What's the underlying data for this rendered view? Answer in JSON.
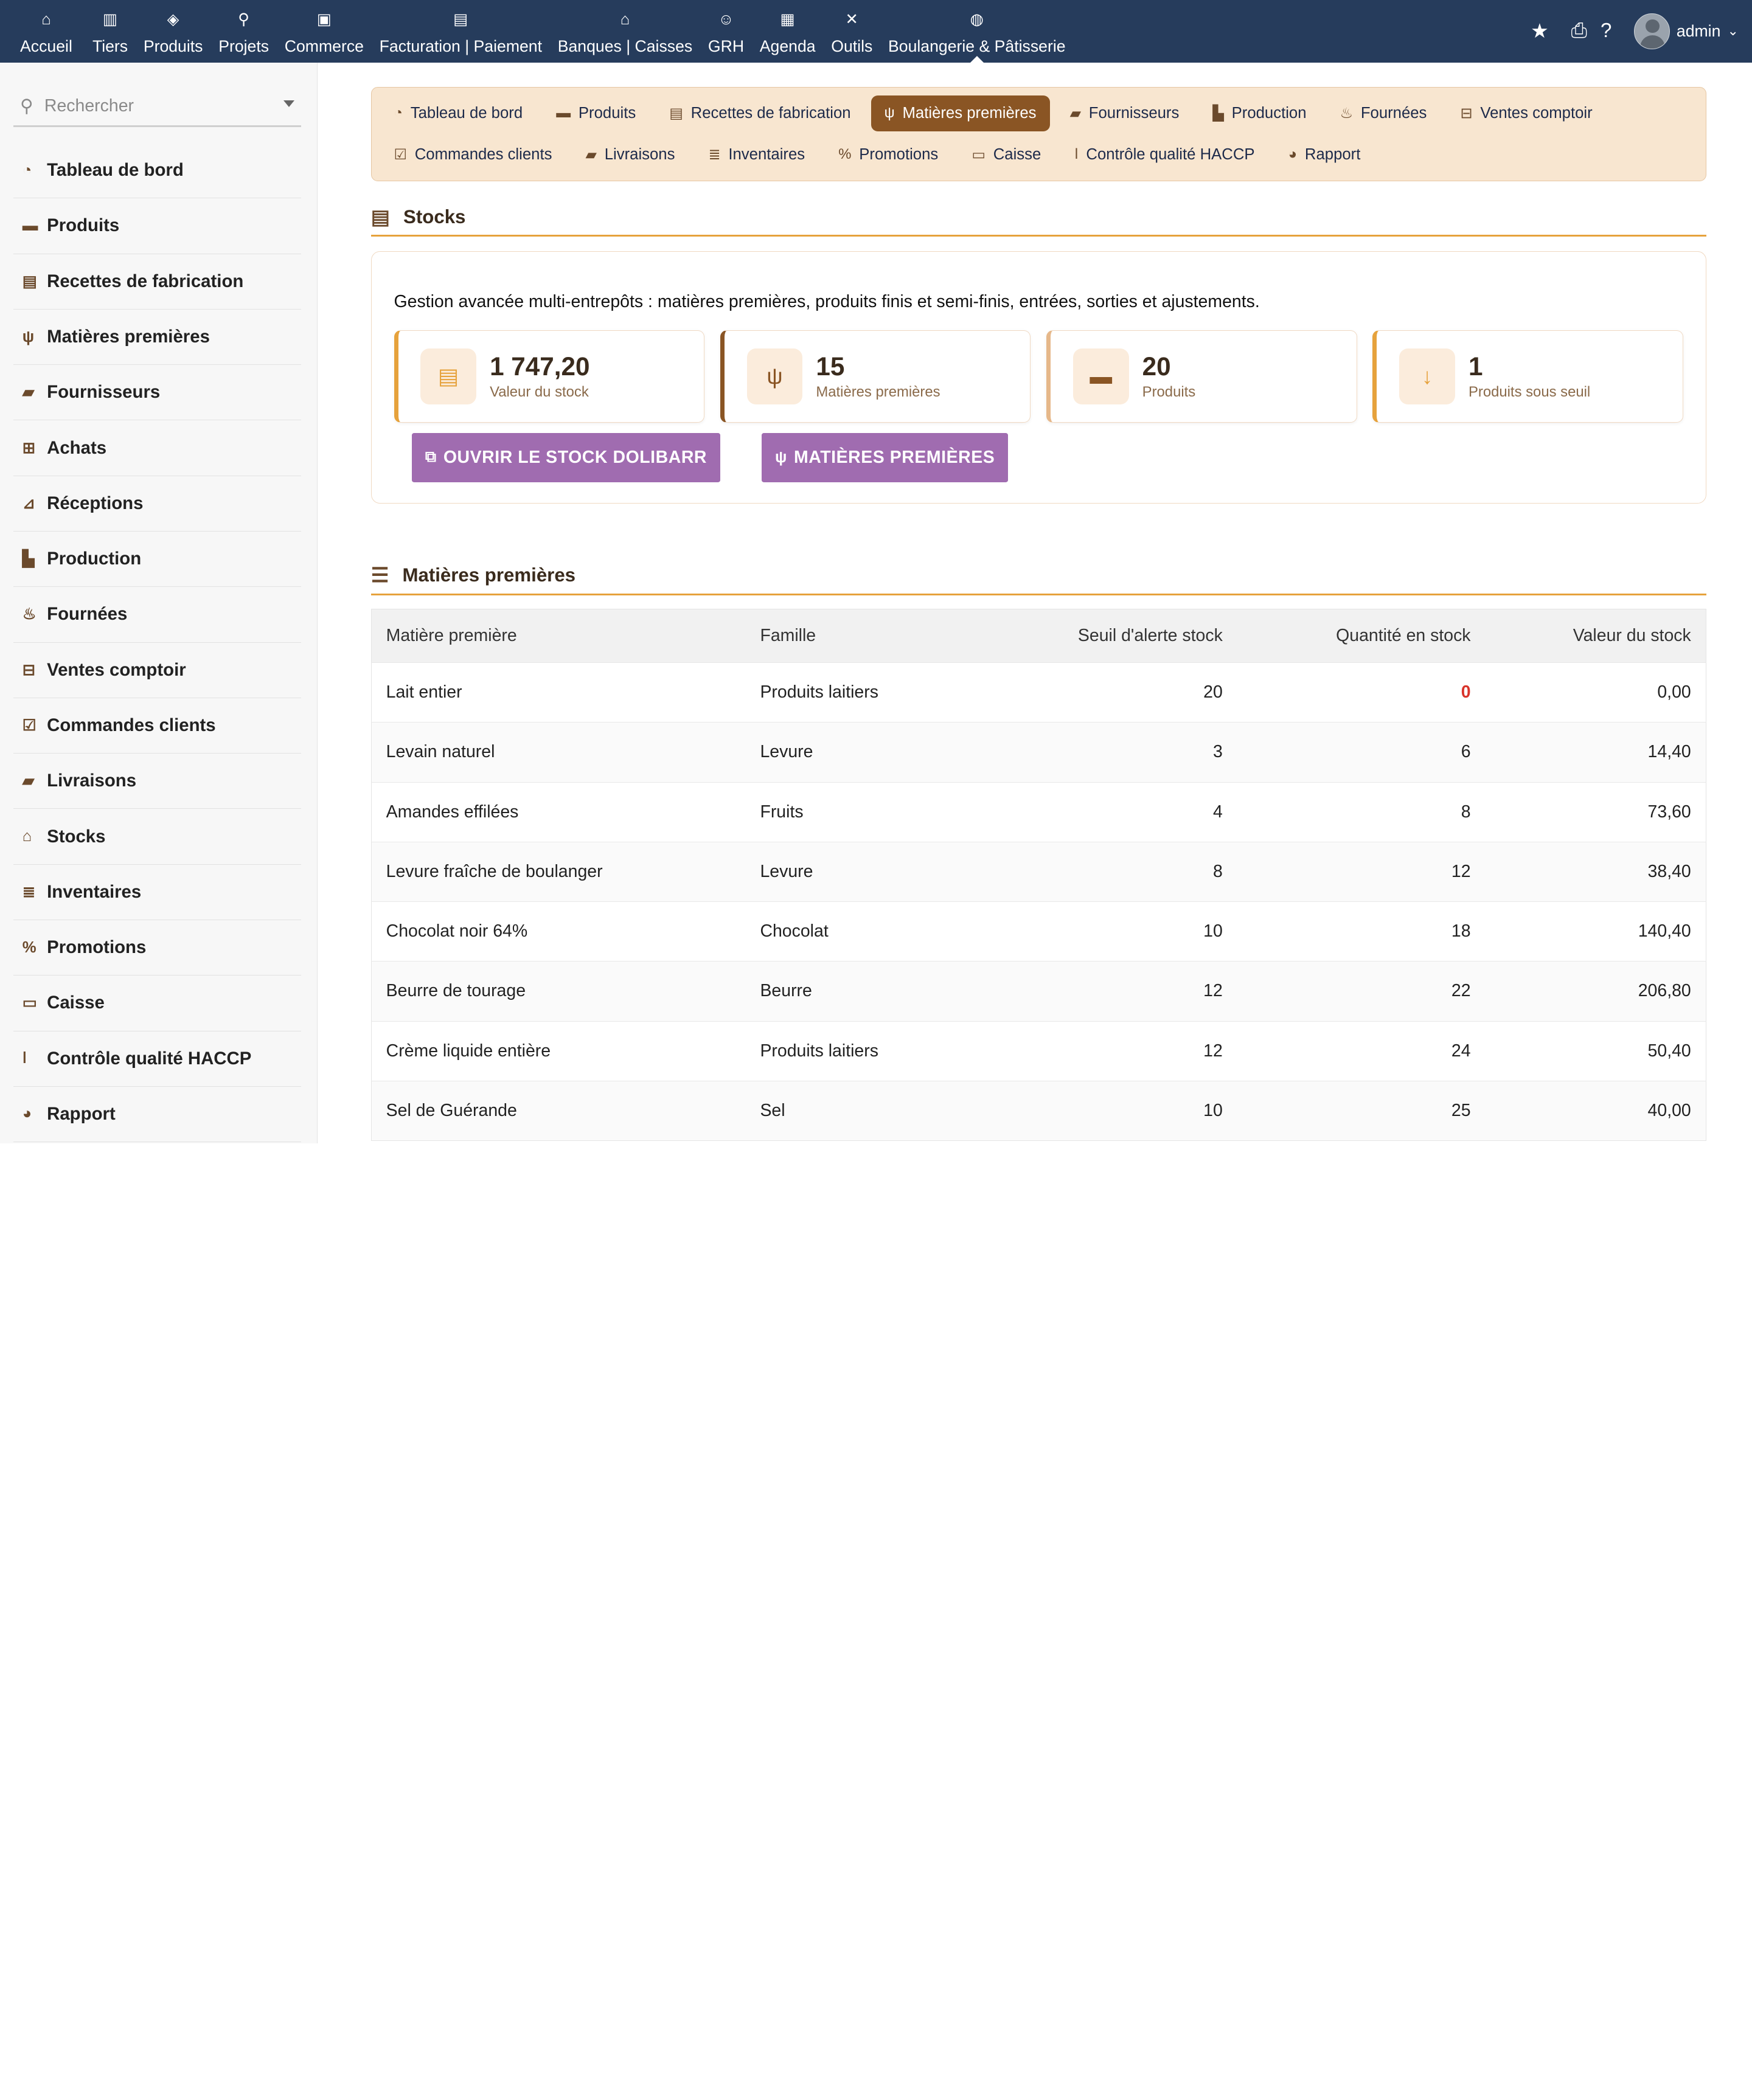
{
  "topmenu": [
    {
      "icon": "home-icon",
      "glyph": "⌂",
      "label": "Accueil"
    },
    {
      "icon": "building-icon",
      "glyph": "▥",
      "label": "Tiers"
    },
    {
      "icon": "cube-icon",
      "glyph": "◈",
      "label": "Produits"
    },
    {
      "icon": "project-icon",
      "glyph": "⚲",
      "label": "Projets"
    },
    {
      "icon": "briefcase-icon",
      "glyph": "▣",
      "label": "Commerce"
    },
    {
      "icon": "invoice-icon",
      "glyph": "▤",
      "label": "Facturation | Paiement"
    },
    {
      "icon": "bank-icon",
      "glyph": "⌂",
      "label": "Banques | Caisses"
    },
    {
      "icon": "user-icon",
      "glyph": "☺",
      "label": "GRH"
    },
    {
      "icon": "calendar-icon",
      "glyph": "▦",
      "label": "Agenda"
    },
    {
      "icon": "tools-icon",
      "glyph": "✕",
      "label": "Outils"
    },
    {
      "icon": "bakery-icon",
      "glyph": "◍",
      "label": "Boulangerie & Pâtisserie"
    }
  ],
  "user": {
    "name": "admin"
  },
  "sidebar": {
    "search_placeholder": "Rechercher",
    "items": [
      {
        "label": "Tableau de bord",
        "icon": "dashboard-icon",
        "glyph": "◔"
      },
      {
        "label": "Produits",
        "icon": "bread-icon",
        "glyph": "▬"
      },
      {
        "label": "Recettes de fabrication",
        "icon": "book-icon",
        "glyph": "▤"
      },
      {
        "label": "Matières premières",
        "icon": "seedling-icon",
        "glyph": "ψ"
      },
      {
        "label": "Fournisseurs",
        "icon": "truck-icon",
        "glyph": "▰"
      },
      {
        "label": "Achats",
        "icon": "cart-icon",
        "glyph": "⊞"
      },
      {
        "label": "Réceptions",
        "icon": "dolly-icon",
        "glyph": "⊿"
      },
      {
        "label": "Production",
        "icon": "industry-icon",
        "glyph": "▙"
      },
      {
        "label": "Fournées",
        "icon": "fire-icon",
        "glyph": "♨"
      },
      {
        "label": "Ventes comptoir",
        "icon": "cash-register-icon",
        "glyph": "⊟"
      },
      {
        "label": "Commandes clients",
        "icon": "clipboard-check-icon",
        "glyph": "☑"
      },
      {
        "label": "Livraisons",
        "icon": "shipping-icon",
        "glyph": "▰"
      },
      {
        "label": "Stocks",
        "icon": "warehouse-icon",
        "glyph": "⌂"
      },
      {
        "label": "Inventaires",
        "icon": "clipboard-list-icon",
        "glyph": "≣"
      },
      {
        "label": "Promotions",
        "icon": "percent-icon",
        "glyph": "%"
      },
      {
        "label": "Caisse",
        "icon": "money-icon",
        "glyph": "▭"
      },
      {
        "label": "Contrôle qualité HACCP",
        "icon": "thermometer-icon",
        "glyph": "ǀ"
      },
      {
        "label": "Rapport",
        "icon": "chart-pie-icon",
        "glyph": "◕"
      }
    ]
  },
  "subnav": [
    {
      "label": "Tableau de bord",
      "icon": "dashboard-icon",
      "glyph": "◔",
      "active": false
    },
    {
      "label": "Produits",
      "icon": "bread-icon",
      "glyph": "▬",
      "active": false
    },
    {
      "label": "Recettes de fabrication",
      "icon": "book-icon",
      "glyph": "▤",
      "active": false
    },
    {
      "label": "Matières premières",
      "icon": "seedling-icon",
      "glyph": "ψ",
      "active": true
    },
    {
      "label": "Fournisseurs",
      "icon": "truck-icon",
      "glyph": "▰",
      "active": false
    },
    {
      "label": "Production",
      "icon": "industry-icon",
      "glyph": "▙",
      "active": false
    },
    {
      "label": "Fournées",
      "icon": "fire-icon",
      "glyph": "♨",
      "active": false
    },
    {
      "label": "Ventes comptoir",
      "icon": "cash-register-icon",
      "glyph": "⊟",
      "active": false
    },
    {
      "label": "Commandes clients",
      "icon": "clipboard-check-icon",
      "glyph": "☑",
      "active": false
    },
    {
      "label": "Livraisons",
      "icon": "shipping-icon",
      "glyph": "▰",
      "active": false
    },
    {
      "label": "Inventaires",
      "icon": "clipboard-list-icon",
      "glyph": "≣",
      "active": false
    },
    {
      "label": "Promotions",
      "icon": "percent-icon",
      "glyph": "%",
      "active": false
    },
    {
      "label": "Caisse",
      "icon": "money-icon",
      "glyph": "▭",
      "active": false
    },
    {
      "label": "Contrôle qualité HACCP",
      "icon": "thermometer-icon",
      "glyph": "ǀ",
      "active": false
    },
    {
      "label": "Rapport",
      "icon": "chart-pie-icon",
      "glyph": "◕",
      "active": false
    }
  ],
  "stocks": {
    "title": "Stocks",
    "description": "Gestion avancée multi-entrepôts : matières premières, produits finis et semi-finis, entrées, sorties et ajustements.",
    "kpis": [
      {
        "value": "1 747,20",
        "label": "Valeur du stock",
        "icon": "warehouse-icon",
        "glyph": "▤"
      },
      {
        "value": "15",
        "label": "Matières premières",
        "icon": "seedling-icon",
        "glyph": "ψ"
      },
      {
        "value": "20",
        "label": "Produits",
        "icon": "bread-icon",
        "glyph": "▬"
      },
      {
        "value": "1",
        "label": "Produits sous seuil",
        "icon": "arrow-down-icon",
        "glyph": "↓"
      }
    ],
    "buttons": {
      "open_stock": "OUVRIR LE STOCK DOLIBARR",
      "raw_materials": "MATIÈRES PREMIÈRES"
    }
  },
  "table": {
    "title": "Matières premières",
    "columns": [
      "Matière première",
      "Famille",
      "Seuil d'alerte stock",
      "Quantité en stock",
      "Valeur du stock"
    ],
    "rows": [
      {
        "name": "Lait entier",
        "family": "Produits laitiers",
        "threshold": "20",
        "qty": "0",
        "value": "0,00",
        "alert": true
      },
      {
        "name": "Levain naturel",
        "family": "Levure",
        "threshold": "3",
        "qty": "6",
        "value": "14,40",
        "alert": false
      },
      {
        "name": "Amandes effilées",
        "family": "Fruits",
        "threshold": "4",
        "qty": "8",
        "value": "73,60",
        "alert": false
      },
      {
        "name": "Levure fraîche de boulanger",
        "family": "Levure",
        "threshold": "8",
        "qty": "12",
        "value": "38,40",
        "alert": false
      },
      {
        "name": "Chocolat noir 64%",
        "family": "Chocolat",
        "threshold": "10",
        "qty": "18",
        "value": "140,40",
        "alert": false
      },
      {
        "name": "Beurre de tourage",
        "family": "Beurre",
        "threshold": "12",
        "qty": "22",
        "value": "206,80",
        "alert": false
      },
      {
        "name": "Crème liquide entière",
        "family": "Produits laitiers",
        "threshold": "12",
        "qty": "24",
        "value": "50,40",
        "alert": false
      },
      {
        "name": "Sel de Guérande",
        "family": "Sel",
        "threshold": "10",
        "qty": "25",
        "value": "40,00",
        "alert": false
      }
    ]
  }
}
